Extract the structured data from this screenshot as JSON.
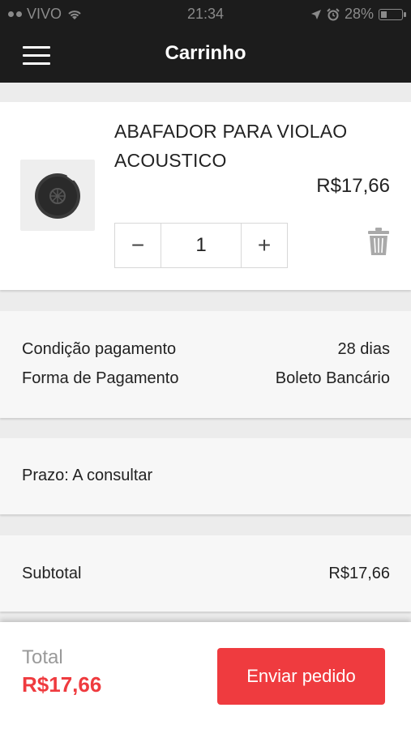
{
  "status_bar": {
    "carrier": "VIVO",
    "time": "21:34",
    "battery": "28%",
    "battery_level": 0.28
  },
  "header": {
    "title": "Carrinho",
    "menu_icon": "hamburger-menu-icon"
  },
  "cart_item": {
    "name": "ABAFADOR PARA VIOLAO ACOUSTICO",
    "price": "R$17,66",
    "quantity": "1",
    "decrement_label": "−",
    "increment_label": "+",
    "image_icon": "guitar-soundhole-cover-image"
  },
  "payment": {
    "condition_label": "Condição pagamento",
    "condition_value": "28 dias",
    "method_label": "Forma de Pagamento",
    "method_value": "Boleto Bancário"
  },
  "delivery": {
    "term": "Prazo: A consultar"
  },
  "summary": {
    "subtotal_label": "Subtotal",
    "subtotal_value": "R$17,66"
  },
  "footer": {
    "total_label": "Total",
    "total_value": "R$17,66",
    "send_button": "Enviar pedido"
  },
  "colors": {
    "accent": "#ef3b3f",
    "header_bg": "#1c1c1c"
  }
}
